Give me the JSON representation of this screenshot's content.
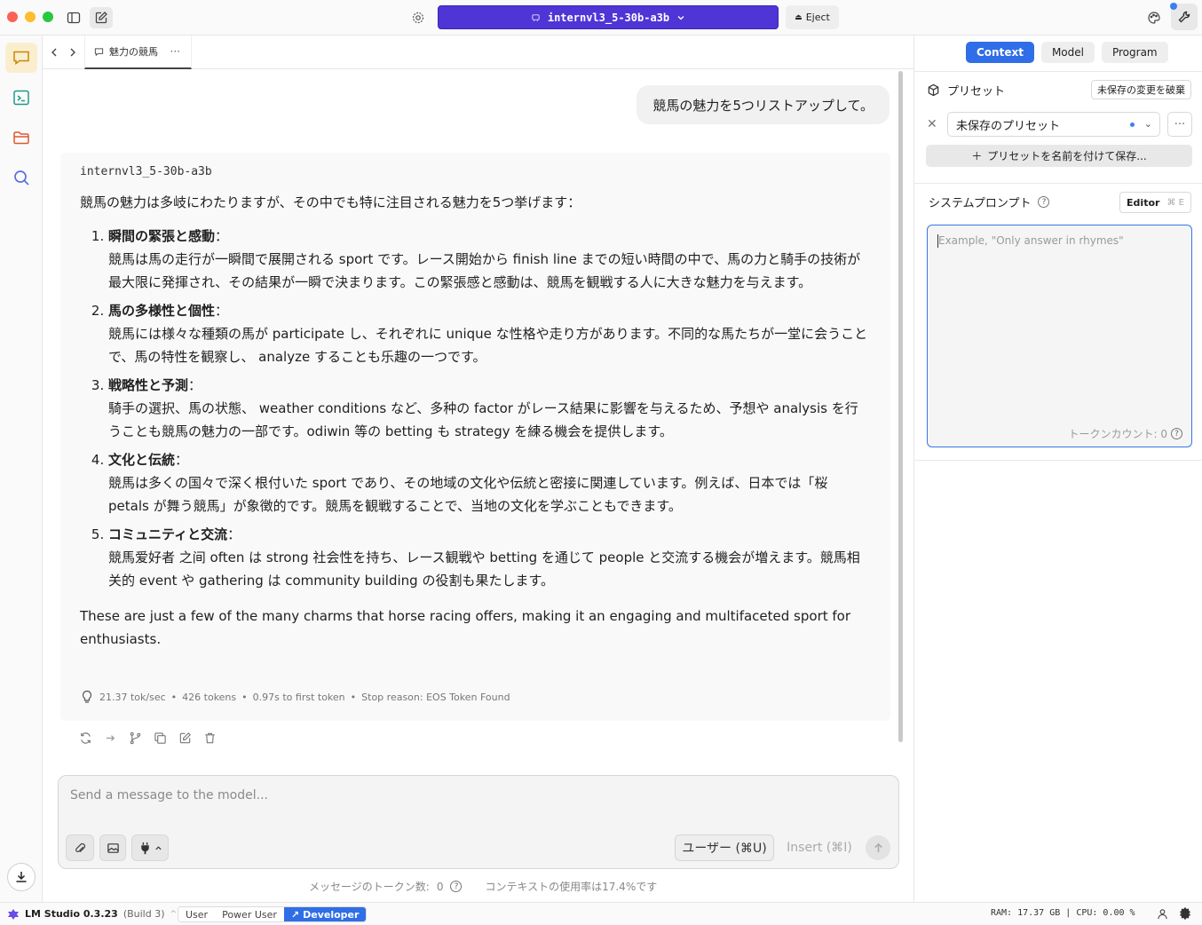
{
  "titlebar": {
    "model_name": "internvl3_5-30b-a3b",
    "eject_label": "Eject"
  },
  "tab": {
    "title": "魅力の競馬"
  },
  "chat": {
    "user_message": "競馬の魅力を5つリストアップして。",
    "assistant_model": "internvl3_5-30b-a3b",
    "intro": "競馬の魅力は多岐にわたりますが、その中でも特に注目される魅力を5つ挙げます：",
    "points": [
      {
        "head": "瞬間の緊張と感動",
        "body": "競馬は馬の走行が一瞬間で展開される sport です。レース開始から finish line までの短い時間の中で、馬の力と騎手の技術が最大限に発揮され、その結果が一瞬で決まります。この緊張感と感動は、競馬を観戦する人に大きな魅力を与えます。"
      },
      {
        "head": "馬の多様性と個性",
        "body": "競馬には様々な種類の馬が participate し、それぞれに unique な性格や走り方があります。不同的な馬たちが一堂に会うことで、馬の特性を観察し、 analyze することも乐趣の一つです。"
      },
      {
        "head": "戦略性と予測",
        "body": "騎手の選択、馬の状態、 weather conditions など、多种の factor がレース結果に影響を与えるため、予想や analysis を行うことも競馬の魅力の一部です。odiwin 等の betting も strategy を練る機会を提供します。"
      },
      {
        "head": "文化と伝統",
        "body": "競馬は多くの国々で深く根付いた sport であり、その地域の文化や伝統と密接に関連しています。例えば、日本では「桜 petals が舞う競馬」が象徴的です。競馬を観戦することで、当地の文化を学ぶこともできます。"
      },
      {
        "head": "コミュニティと交流",
        "body": "競馬爱好者 之间 often は strong 社会性を持ち、レース観戦や betting を通じて people と交流する機会が増えます。競馬相关的 event や gathering は community building の役割も果たします。"
      }
    ],
    "point_suffix": "：",
    "outro": "These are just a few of the many charms that horse racing offers, making it an engaging and multifaceted sport for enthusiasts.",
    "stats": {
      "speed": "21.37 tok/sec",
      "tokens": "426 tokens",
      "first_token": "0.97s to first token",
      "stop_reason": "Stop reason: EOS Token Found",
      "separator": "•"
    }
  },
  "input": {
    "placeholder": "Send a message to the model...",
    "role_label": "ユーザー (⌘U)",
    "insert_label": "Insert (⌘I)",
    "token_label": "メッセージのトークン数:",
    "token_value": "0",
    "context_usage": "コンテキストの使用率は17.4%です"
  },
  "right_panel": {
    "tabs": [
      "Context",
      "Model",
      "Program"
    ],
    "active_tab": "Context",
    "preset_label": "プリセット",
    "discard_label": "未保存の変更を破棄",
    "preset_value": "未保存のプリセット",
    "save_preset_label": "プリセットを名前を付けて保存...",
    "system_prompt_label": "システムプロンプト",
    "editor_label": "Editor",
    "editor_shortcut": "⌘ E",
    "system_prompt_placeholder": "Example, \"Only answer in rhymes\"",
    "token_count": "トークンカウント: 0"
  },
  "statusbar": {
    "app_name": "LM Studio 0.3.23",
    "build": "(Build 3)",
    "modes": [
      "User",
      "Power User",
      "Developer"
    ],
    "active_mode": "Developer",
    "sysinfo": "RAM: 17.37 GB | CPU: 0.00 %"
  },
  "colors": {
    "accent": "#4f35d6",
    "blue": "#2f6ee6",
    "rail_active": "#fbeecf"
  }
}
